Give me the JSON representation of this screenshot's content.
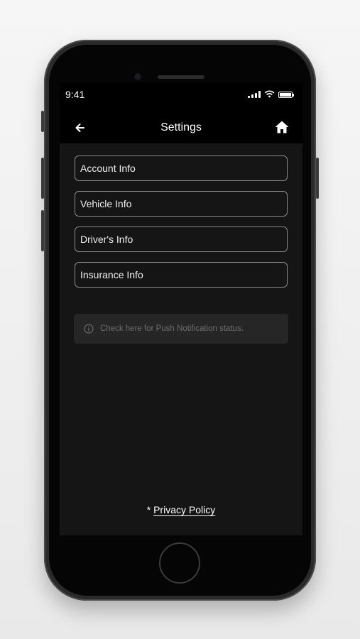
{
  "status_bar": {
    "time": "9:41"
  },
  "header": {
    "title": "Settings",
    "back_icon": "arrow-left-icon",
    "home_icon": "home-icon"
  },
  "menu": {
    "items": [
      {
        "label": "Account Info"
      },
      {
        "label": "Vehicle Info"
      },
      {
        "label": "Driver's Info"
      },
      {
        "label": "Insurance Info"
      }
    ]
  },
  "notice": {
    "text": "Check here for Push Notification status.",
    "icon": "info-icon"
  },
  "footer": {
    "prefix": "*",
    "privacy_label": "Privacy Policy"
  },
  "colors": {
    "screen_background": "#151515",
    "header_background": "#000000",
    "menu_border": "#8a8a8a",
    "notice_background": "#262626",
    "notice_text": "#6d6d6d"
  }
}
